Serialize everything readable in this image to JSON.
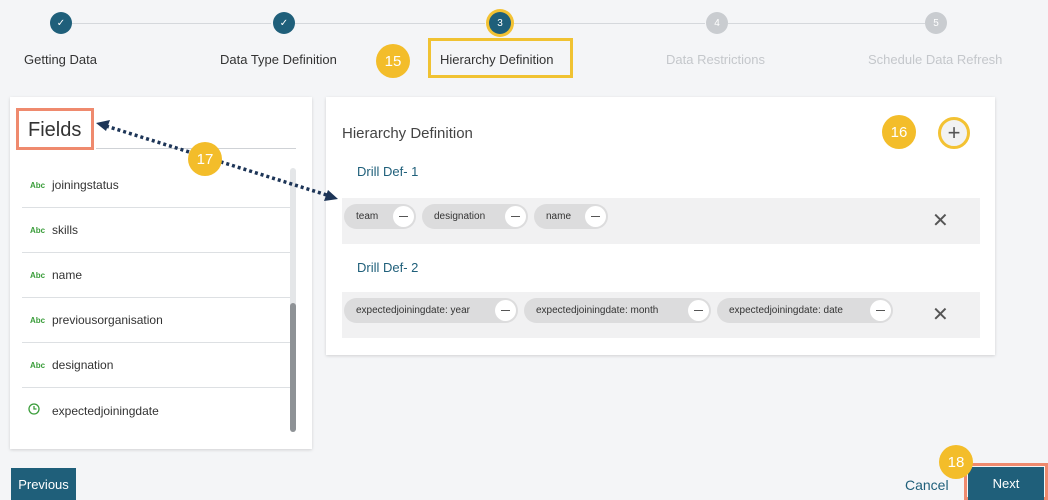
{
  "stepper": {
    "steps": [
      {
        "label": "Getting Data",
        "marker": "✓",
        "state": "done"
      },
      {
        "label": "Data Type Definition",
        "marker": "✓",
        "state": "done"
      },
      {
        "label": "Hierarchy Definition",
        "marker": "3",
        "state": "current"
      },
      {
        "label": "Data Restrictions",
        "marker": "4",
        "state": "pending"
      },
      {
        "label": "Schedule Data Refresh",
        "marker": "5",
        "state": "pending"
      }
    ]
  },
  "callouts": {
    "c15": "15",
    "c16": "16",
    "c17": "17",
    "c18": "18"
  },
  "fields": {
    "title": "Fields",
    "type_abc": "Abc",
    "items": [
      {
        "name": "joiningstatus",
        "icon": "abc-icon"
      },
      {
        "name": "skills",
        "icon": "abc-icon"
      },
      {
        "name": "name",
        "icon": "abc-icon"
      },
      {
        "name": "previousorganisation",
        "icon": "abc-icon"
      },
      {
        "name": "designation",
        "icon": "abc-icon"
      },
      {
        "name": "expectedjoiningdate",
        "icon": "clock-icon"
      }
    ]
  },
  "hierarchy": {
    "title": "Hierarchy Definition",
    "add_icon": "+",
    "drills": [
      {
        "label": "Drill Def- 1",
        "chips": [
          "team",
          "designation",
          "name"
        ]
      },
      {
        "label": "Drill Def- 2",
        "chips": [
          "expectedjoiningdate: year",
          "expectedjoiningdate: month",
          "expectedjoiningdate: date"
        ]
      }
    ]
  },
  "footer": {
    "previous": "Previous",
    "cancel": "Cancel",
    "next": "Next"
  },
  "colors": {
    "primary": "#1f5f7a",
    "highlight_yellow": "#f3c233",
    "highlight_orange": "#ef8a6e"
  }
}
